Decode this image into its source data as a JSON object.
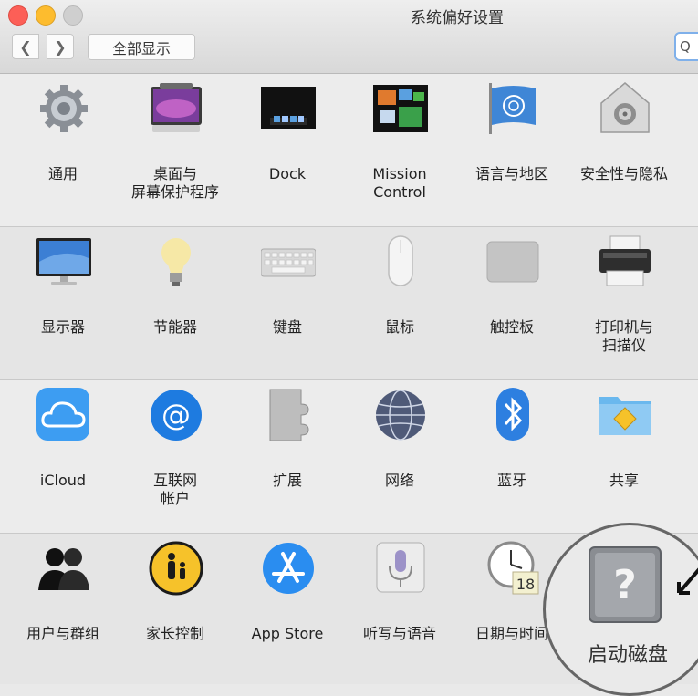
{
  "window": {
    "title": "系统偏好设置",
    "show_all": "全部显示",
    "search_glyph": "Q"
  },
  "rows": [
    [
      {
        "label": "通用",
        "icon": "gear-icon"
      },
      {
        "label": "桌面与\n屏幕保护程序",
        "icon": "desktop-icon"
      },
      {
        "label": "Dock",
        "icon": "dock-icon"
      },
      {
        "label": "Mission\nControl",
        "icon": "mission-control-icon"
      },
      {
        "label": "语言与地区",
        "icon": "un-flag-icon"
      },
      {
        "label": "安全性与隐私",
        "icon": "vault-icon"
      }
    ],
    [
      {
        "label": "显示器",
        "icon": "monitor-icon"
      },
      {
        "label": "节能器",
        "icon": "bulb-icon"
      },
      {
        "label": "键盘",
        "icon": "keyboard-icon"
      },
      {
        "label": "鼠标",
        "icon": "mouse-icon"
      },
      {
        "label": "触控板",
        "icon": "trackpad-icon"
      },
      {
        "label": "打印机与\n扫描仪",
        "icon": "printer-icon"
      }
    ],
    [
      {
        "label": "iCloud",
        "icon": "icloud-icon"
      },
      {
        "label": "互联网\n帐户",
        "icon": "at-icon"
      },
      {
        "label": "扩展",
        "icon": "puzzle-icon"
      },
      {
        "label": "网络",
        "icon": "globe-icon"
      },
      {
        "label": "蓝牙",
        "icon": "bluetooth-icon"
      },
      {
        "label": "共享",
        "icon": "shared-folder-icon"
      }
    ],
    [
      {
        "label": "用户与群组",
        "icon": "users-icon"
      },
      {
        "label": "家长控制",
        "icon": "parental-icon"
      },
      {
        "label": "App Store",
        "icon": "app-store-icon"
      },
      {
        "label": "听写与语音",
        "icon": "microphone-icon"
      },
      {
        "label": "日期与时间",
        "icon": "clock-icon"
      }
    ]
  ],
  "startup_disk": {
    "label": "启动磁盘",
    "icon": "hard-disk-icon"
  },
  "calendar_day": "18"
}
